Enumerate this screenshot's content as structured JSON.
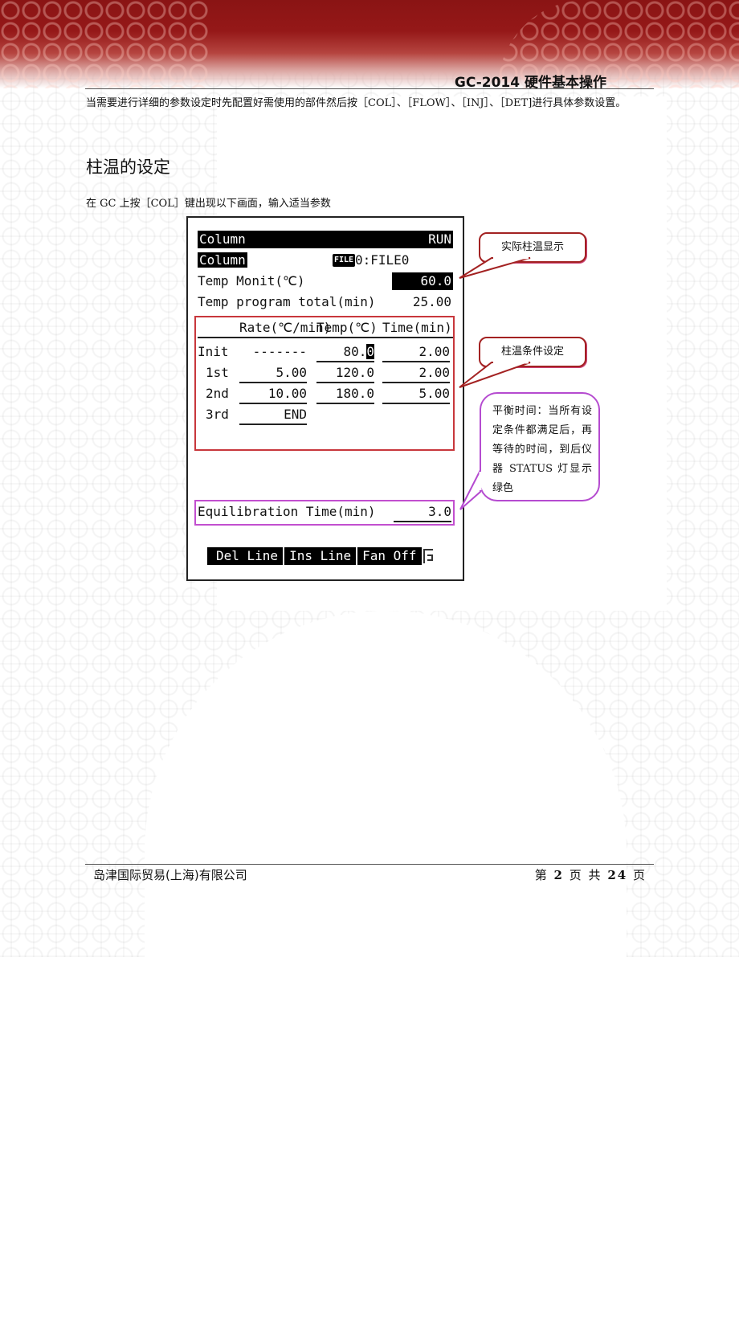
{
  "header": {
    "doc_title": "GC-2014 硬件基本操作"
  },
  "intro": {
    "text": "当需要进行详细的参数设定时先配置好需使用的部件然后按［COL］、［FLOW］、［INJ］、［DET]进行具体参数设置。"
  },
  "section": {
    "title": "柱温的设定",
    "instruction": "在 GC 上按［COL］键出现以下画面，输入适当参数"
  },
  "lcd": {
    "title": "Column",
    "status": "RUN",
    "subtitle": "Column",
    "file_badge": "FILE",
    "file_name": "0:FILE0",
    "temp_monit_label": "Temp Monit(℃)",
    "temp_monit_value": "60.0",
    "temp_total_label": "Temp program total(min)",
    "temp_total_value": "25.00",
    "table": {
      "headers": [
        "Rate(℃/min)",
        "Temp(℃)",
        "Time(min)"
      ],
      "rows": [
        {
          "label": "Init",
          "rate": "-------",
          "temp": "80.",
          "temp_cursor": "0",
          "time": "2.00"
        },
        {
          "label": "1st",
          "rate": "5.00",
          "temp": "120.0",
          "time": "2.00"
        },
        {
          "label": "2nd",
          "rate": "10.00",
          "temp": "180.0",
          "time": "5.00"
        },
        {
          "label": "3rd",
          "rate": "END",
          "temp": "",
          "time": ""
        }
      ]
    },
    "equilibration_label": "Equilibration Time(min)",
    "equilibration_value": "3.0",
    "softkeys": [
      "Del Line",
      "Ins Line",
      "Fan Off"
    ]
  },
  "callouts": {
    "actual_temp": "实际柱温显示",
    "temp_conditions": "柱温条件设定",
    "equilibration": "平衡时间：当所有设定条件都满足后，再等待的时间，到后仪器 STATUS 灯显示绿色"
  },
  "colors": {
    "banner_red": "#8a1414",
    "highlight_red": "#c8373c",
    "highlight_purple": "#c24fcf",
    "callout_border_red": "#a32222"
  },
  "footer": {
    "company": "岛津国际贸易(上海)有限公司",
    "page_prefix": "第",
    "page_current": "2",
    "page_mid": "页 共",
    "page_total": "24",
    "page_suffix": "页"
  }
}
